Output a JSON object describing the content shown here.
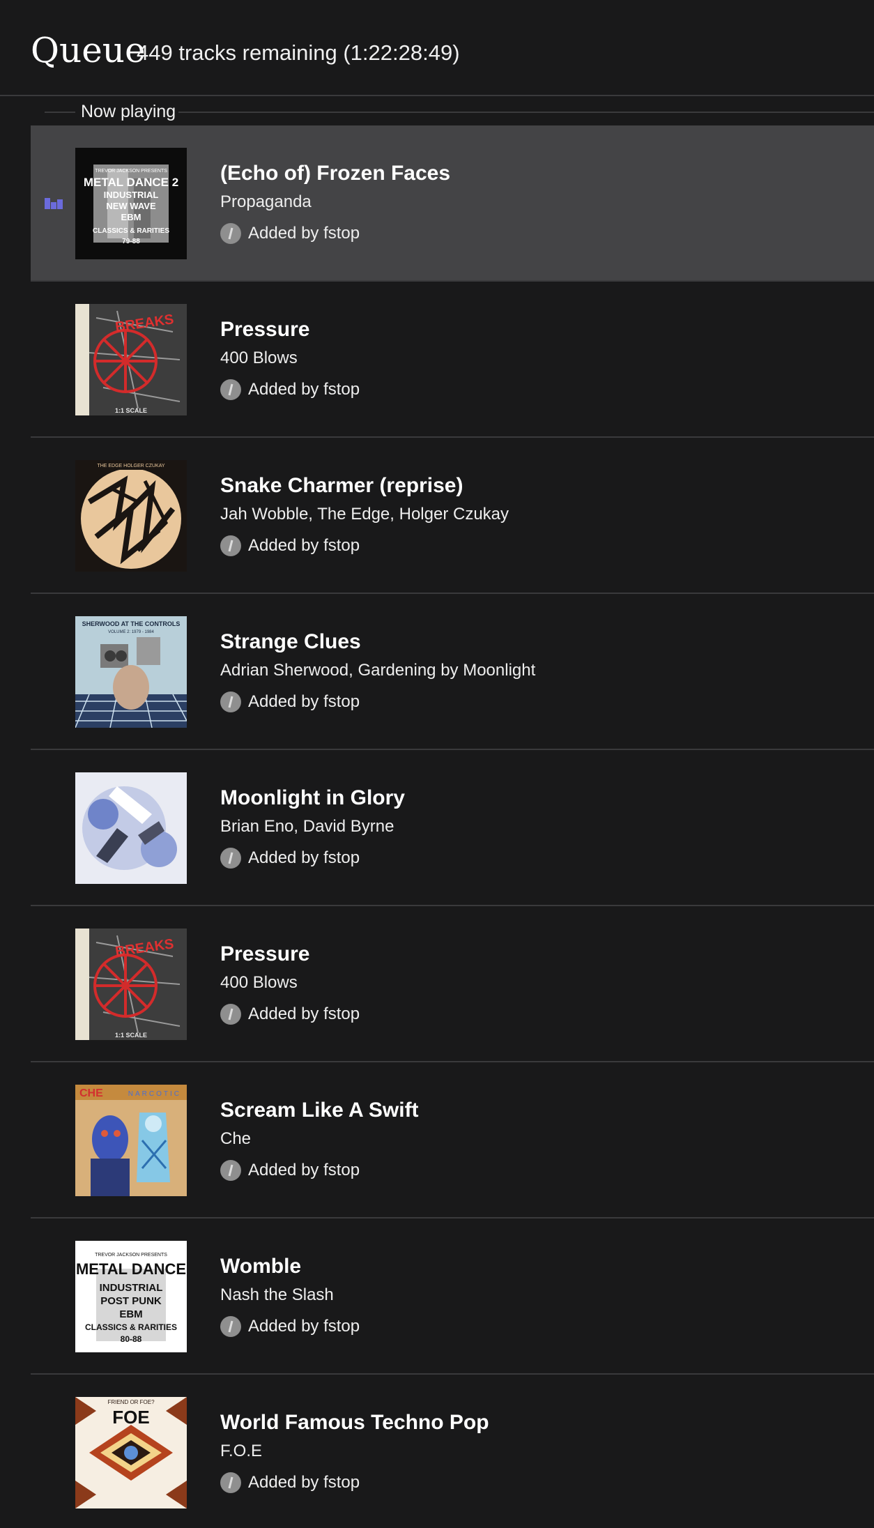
{
  "header": {
    "title": "Queue",
    "subtitle": "449 tracks remaining (1:22:28:49)"
  },
  "now_playing_label": "Now playing",
  "colors": {
    "background": "#19191a",
    "current_row": "#444446",
    "divider": "#3a3a3c",
    "playing_indicator": "#6b6bdc"
  },
  "tracks": [
    {
      "title": "(Echo of) Frozen Faces",
      "artist": "Propaganda",
      "added_by": "Added by fstop",
      "cover": "metal-dance-2-cover",
      "current": true
    },
    {
      "title": "Pressure",
      "artist": "400 Blows",
      "added_by": "Added by fstop",
      "cover": "breaks-cover",
      "current": false
    },
    {
      "title": "Snake Charmer (reprise)",
      "artist": "Jah Wobble, The Edge, Holger Czukay",
      "added_by": "Added by fstop",
      "cover": "snake-charmer-cover",
      "current": false
    },
    {
      "title": "Strange Clues",
      "artist": "Adrian Sherwood, Gardening by Moonlight",
      "added_by": "Added by fstop",
      "cover": "sherwood-at-the-controls-cover",
      "current": false
    },
    {
      "title": "Moonlight in Glory",
      "artist": "Brian Eno, David Byrne",
      "added_by": "Added by fstop",
      "cover": "bush-of-ghosts-cover",
      "current": false
    },
    {
      "title": "Pressure",
      "artist": "400 Blows",
      "added_by": "Added by fstop",
      "cover": "breaks-cover",
      "current": false
    },
    {
      "title": "Scream Like A Swift",
      "artist": "Che",
      "added_by": "Added by fstop",
      "cover": "che-narcotic-cover",
      "current": false
    },
    {
      "title": "Womble",
      "artist": "Nash the Slash",
      "added_by": "Added by fstop",
      "cover": "metal-dance-cover",
      "current": false
    },
    {
      "title": "World Famous Techno Pop",
      "artist": "F.O.E",
      "added_by": "Added by fstop",
      "cover": "foe-cover",
      "current": false
    }
  ],
  "cover_art_text": {
    "metal_dance_2": [
      "TREVOR JACKSON PRESENTS",
      "METAL DANCE 2",
      "INDUSTRIAL",
      "NEW WAVE",
      "EBM",
      "CLASSICS & RARITIES",
      "79-88"
    ],
    "breaks": [
      "BREAKS",
      "1:1 SCALE"
    ],
    "snake_charmer": [
      "THE EDGE HOLGER CZUKAY"
    ],
    "sherwood": [
      "SHERWOOD AT THE CONTROLS",
      "VOLUME 2: 1979 - 1984"
    ],
    "che": [
      "CHE",
      "NARCOTIC"
    ],
    "metal_dance": [
      "TREVOR JACKSON PRESENTS",
      "METAL DANCE",
      "INDUSTRIAL",
      "POST PUNK",
      "EBM",
      "CLASSICS & RARITIES",
      "80-88"
    ],
    "foe": [
      "FRIEND OR FOE?",
      "FOE"
    ]
  }
}
